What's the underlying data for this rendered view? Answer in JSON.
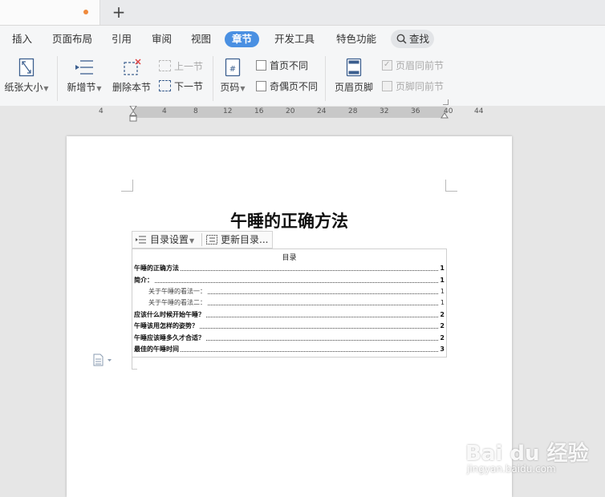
{
  "tabs": {
    "add_label": "+"
  },
  "menubar": {
    "items": [
      "插入",
      "页面布局",
      "引用",
      "审阅",
      "视图",
      "章节",
      "开发工具",
      "特色功能"
    ],
    "active": "章节",
    "search_label": "查找"
  },
  "ribbon": {
    "paper_size": "纸张大小",
    "new_section": "新增节",
    "delete_section": "删除本节",
    "prev_section": "上一节",
    "next_section": "下一节",
    "page_number": "页码",
    "first_page_diff": "首页不同",
    "odd_even_diff": "奇偶页不同",
    "header_footer": "页眉页脚",
    "header_same_prev": "页眉同前节",
    "footer_same_prev": "页脚同前节"
  },
  "ruler": {
    "ticks": [
      "4",
      "4",
      "8",
      "12",
      "16",
      "20",
      "24",
      "28",
      "32",
      "36",
      "40",
      "44"
    ]
  },
  "document": {
    "title": "午睡的正确方法",
    "toc_settings": "目录设置",
    "toc_update": "更新目录...",
    "toc_heading": "目录",
    "toc": [
      {
        "text": "午睡的正确方法",
        "page": "1",
        "level": 1
      },
      {
        "text": "简介：",
        "page": "1",
        "level": 1
      },
      {
        "text": "关于午睡的看法一：",
        "page": "1",
        "level": 2
      },
      {
        "text": "关于午睡的看法二：",
        "page": "1",
        "level": 2
      },
      {
        "text": "应该什么时候开始午睡？",
        "page": "2",
        "level": 1
      },
      {
        "text": "午睡该用怎样的姿势？",
        "page": "2",
        "level": 1
      },
      {
        "text": "午睡应该睡多久才合适？",
        "page": "2",
        "level": 1
      },
      {
        "text": "最佳的午睡时间",
        "page": "3",
        "level": 1
      }
    ]
  },
  "watermark": {
    "logo": "Bai du 经验",
    "url": "jingyan.baidu.com"
  },
  "colors": {
    "accent": "#4a90e2",
    "unsaved_dot": "#f08a3c"
  }
}
